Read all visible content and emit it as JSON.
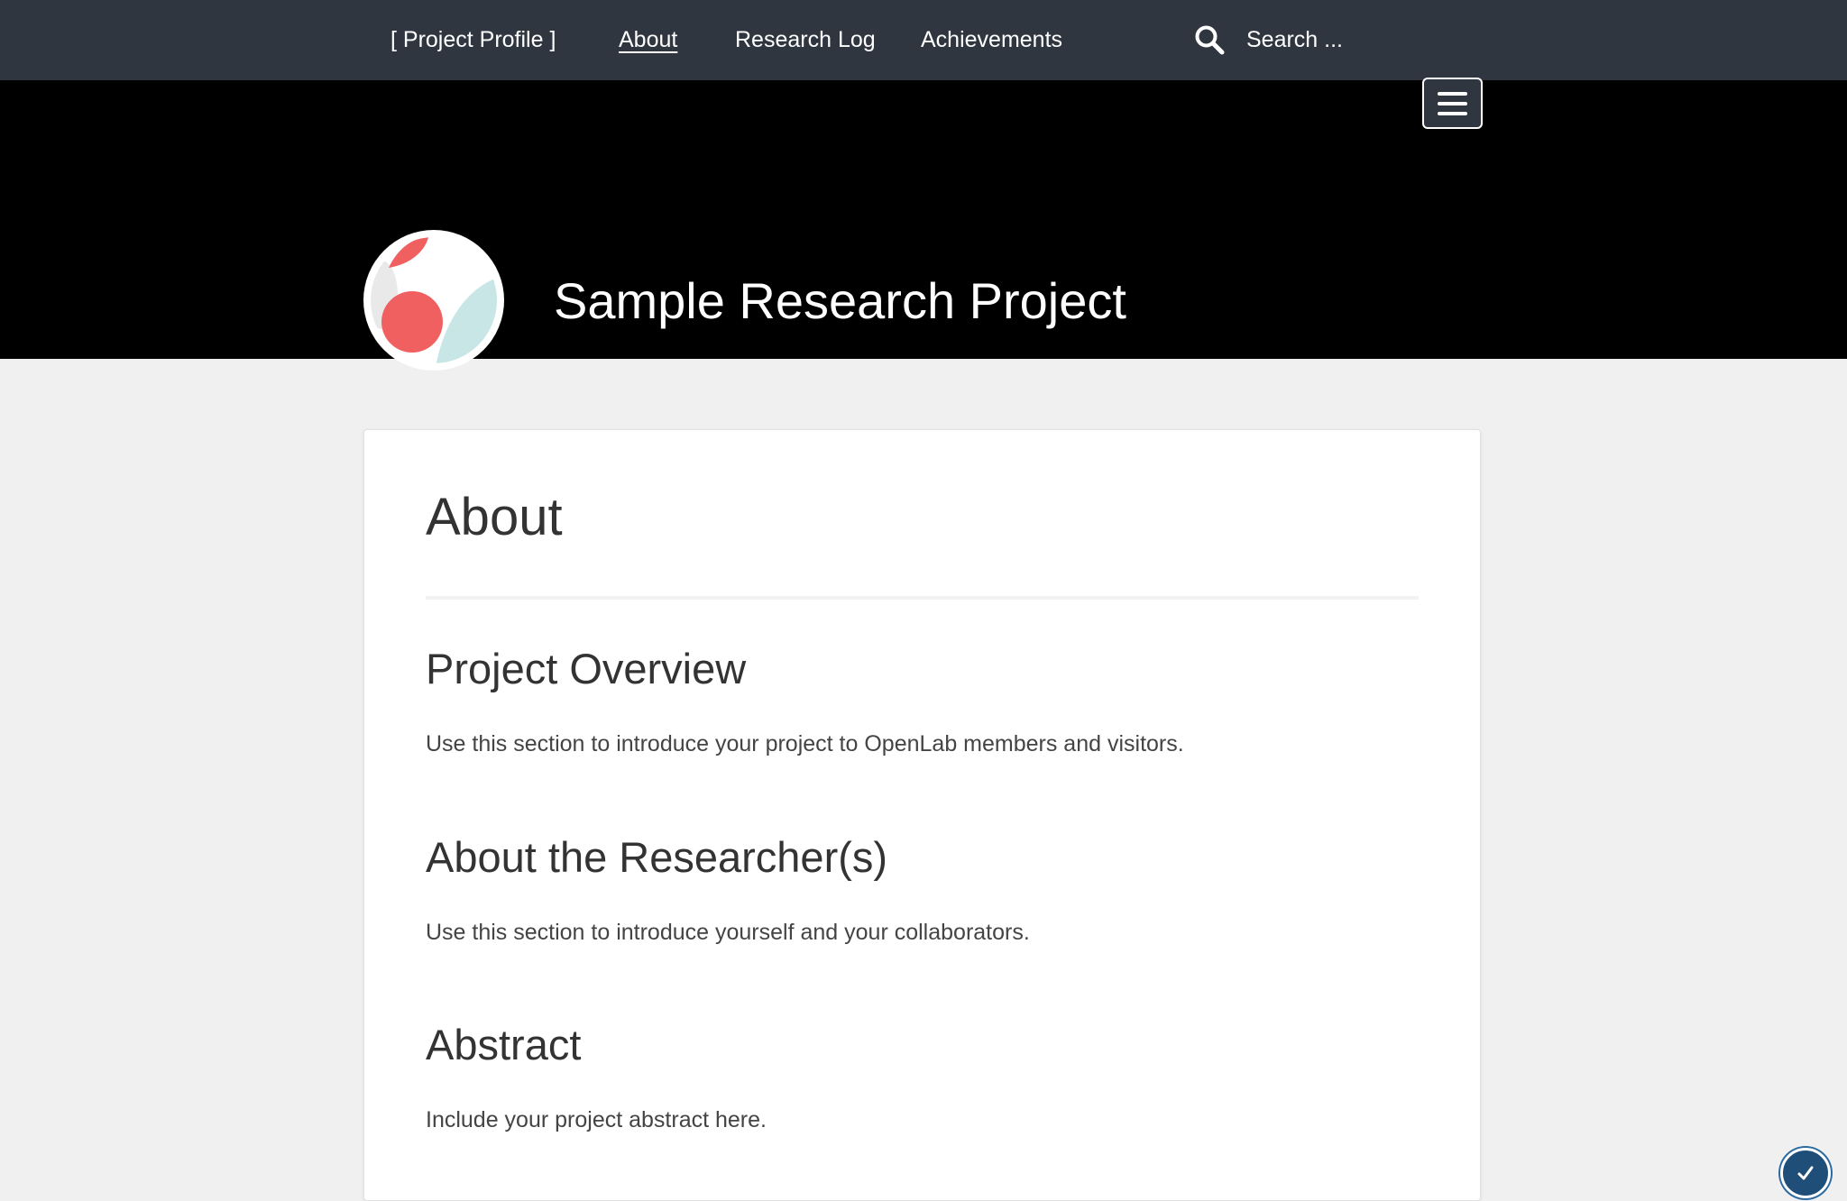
{
  "nav": {
    "profile_label": "[ Project Profile ]",
    "about_label": "About",
    "research_log_label": "Research Log",
    "achievements_label": "Achievements",
    "search_placeholder": "Search ...",
    "search_icon": "search-icon",
    "background_color": "#2f3640"
  },
  "header": {
    "site_title": "Sample Research Project",
    "logo_icon": "project-avatar-icon",
    "menu_icon": "hamburger-menu-icon",
    "background_color": "#000000",
    "logo_colors": {
      "coral": "#f06060",
      "mint": "#c8e6e6",
      "grey": "#e9e9e9"
    }
  },
  "content": {
    "page_title": "About",
    "sections": [
      {
        "heading": "Project Overview",
        "text": "Use this section to introduce your project to OpenLab members and visitors."
      },
      {
        "heading": "About the Researcher(s)",
        "text": "Use this section to introduce yourself and your collaborators."
      },
      {
        "heading": "Abstract",
        "text": "Include your project abstract here."
      }
    ]
  },
  "widget": {
    "icon": "checkmark-icon",
    "color": "#1f4e79"
  }
}
